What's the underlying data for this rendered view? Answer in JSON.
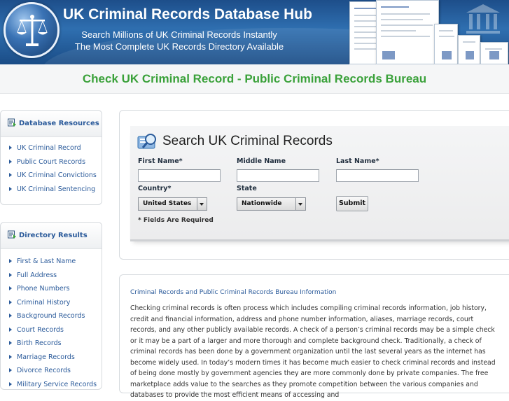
{
  "header": {
    "site_title": "UK Criminal Records Database Hub",
    "tagline_1": "Search Millions of UK Criminal Records Instantly",
    "tagline_2": "The Most Complete UK Records Directory Available",
    "logo_icon": "scales-of-justice-icon"
  },
  "page": {
    "title": "Check UK Criminal Record - Public Criminal Records Bureau"
  },
  "sidebar": {
    "database_resources": {
      "heading": "Database Resources",
      "items": [
        "UK Criminal Record",
        "Public Court Records",
        "UK Criminal Convictions",
        "UK Criminal Sentencing"
      ]
    },
    "directory_results": {
      "heading": "Directory Results",
      "items": [
        "First & Last Name",
        "Full Address",
        "Phone Numbers",
        "Criminal History",
        "Background Records",
        "Court Records",
        "Birth Records",
        "Marriage Records",
        "Divorce Records",
        "Military Service Records"
      ]
    }
  },
  "search_form": {
    "title": "Search UK Criminal Records",
    "first_name_label": "First Name*",
    "middle_name_label": "Middle Name",
    "last_name_label": "Last Name*",
    "country_label": "Country*",
    "state_label": "State",
    "country_value": "United States",
    "state_value": "Nationwide",
    "first_name_value": "",
    "middle_name_value": "",
    "last_name_value": "",
    "submit_label": "Submit",
    "required_note": "* Fields Are Required"
  },
  "info": {
    "title": "Criminal Records and Public Criminal Records Bureau Information",
    "body": "Checking criminal records is often process which includes compiling criminal records information, job history, credit and financial information, address and phone number information, aliases, marriage records, court records, and any other publicly available records. A check of a person’s criminal records may be a simple check or it may be a part of a larger and more thorough and complete background check. Traditionally, a check of criminal records has been done by a government organization until the last several years as the internet has become widely used. In today’s modern times it has become much easier to check criminal records and instead of being done mostly by government agencies they are more commonly done by private companies. The free marketplace adds value to the searches as they promote competition between the various companies and databases to provide the most efficient means of accessing and"
  },
  "colors": {
    "header_blue": "#2f6fb0",
    "title_green": "#3aa13a",
    "link_blue": "#2a5a9a"
  }
}
